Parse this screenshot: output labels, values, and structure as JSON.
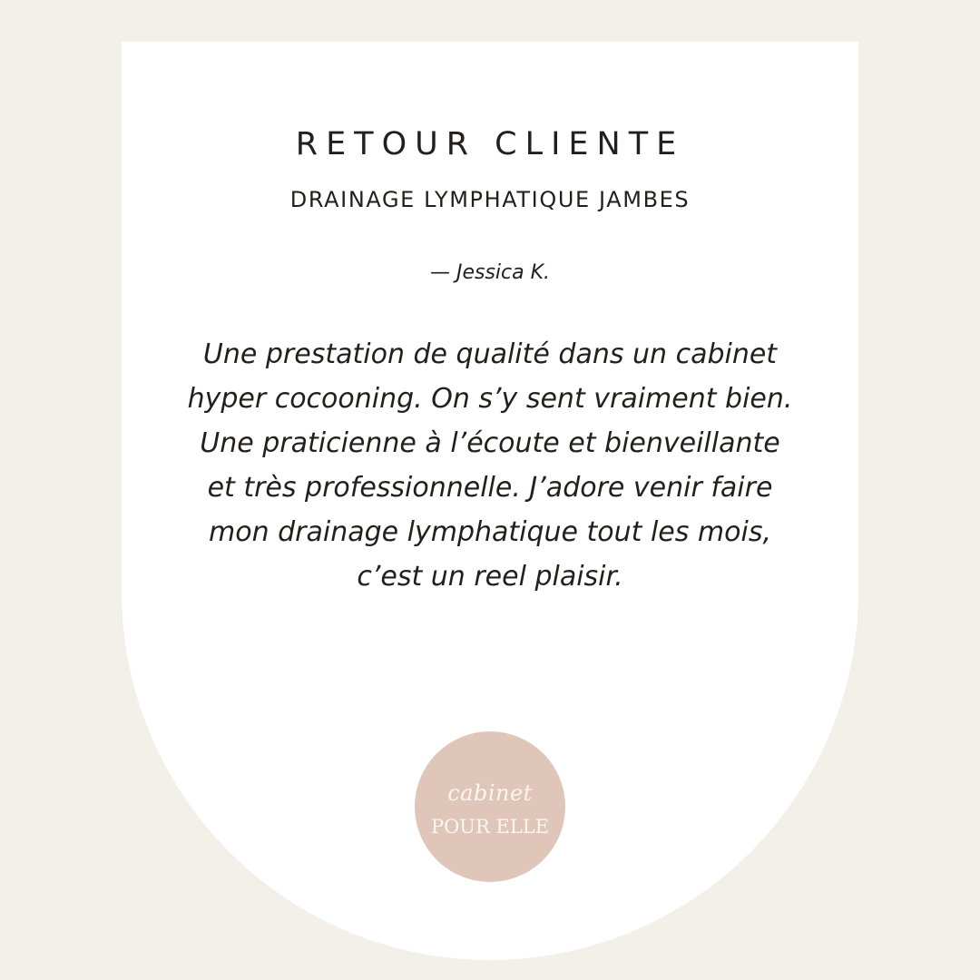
{
  "colors": {
    "background": "#f3efe9",
    "card": "#ffffff",
    "text": "#231f1c",
    "logo_circle": "#e0c6b8",
    "logo_text": "#fbf6f2"
  },
  "heading": {
    "title": "RETOUR CLIENTE",
    "service": "DRAINAGE LYMPHATIQUE JAMBES"
  },
  "testimonial": {
    "author": "— Jessica K.",
    "lines": [
      "Une prestation de qualité dans un cabinet",
      "hyper cocooning. On s’y sent vraiment bien.",
      "Une praticienne à l’écoute et bienveillante",
      "et très professionnelle. J’adore venir faire",
      "mon drainage lymphatique tout les mois,",
      "c’est un reel plaisir."
    ]
  },
  "logo": {
    "script_text": "cabinet",
    "caps_text": "POUR ELLE"
  }
}
